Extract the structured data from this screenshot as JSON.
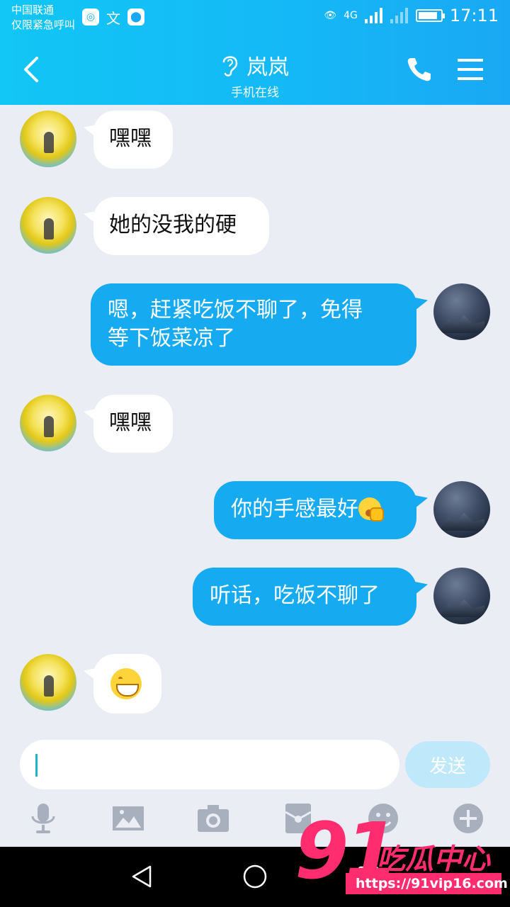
{
  "status_bar": {
    "carrier": "中国联通",
    "carrier_note": "仅限紧急呼叫",
    "network": "4G",
    "time": "17:11",
    "app_icons": [
      "360-icon",
      "translate-icon",
      "maps-icon"
    ]
  },
  "header": {
    "contact_name": "岚岚",
    "status": "手机在线",
    "icons": {
      "back": "chevron-left-icon",
      "ear": "ear-icon",
      "call": "phone-icon",
      "menu": "menu-icon"
    },
    "colors": {
      "gradient_start": "#12c6f5",
      "gradient_end": "#1aa8f4"
    }
  },
  "messages": [
    {
      "from": "friend",
      "text": "嘿嘿"
    },
    {
      "from": "friend",
      "text": "她的没我的硬"
    },
    {
      "from": "self",
      "text_line1": "嗯，赶紧吃饭不聊了，免得",
      "text_line2": "等下饭菜凉了"
    },
    {
      "from": "friend",
      "text": "嘿嘿"
    },
    {
      "from": "self",
      "text": "你的手感最好",
      "emoji": "yawn-emoji"
    },
    {
      "from": "self",
      "text": "听话，吃饭不聊了"
    },
    {
      "from": "friend",
      "emoji": "grin-emoji"
    }
  ],
  "composer": {
    "input_value": "",
    "send_label": "发送",
    "tools": [
      "microphone-icon",
      "image-icon",
      "camera-icon",
      "red-packet-icon",
      "emoji-icon",
      "plus-icon"
    ]
  },
  "nav": [
    "back-triangle-icon",
    "home-circle-icon",
    "recents-square-icon"
  ],
  "watermark": {
    "number": "91",
    "title": "吃瓜中心",
    "url": "https://91vip16.com"
  }
}
